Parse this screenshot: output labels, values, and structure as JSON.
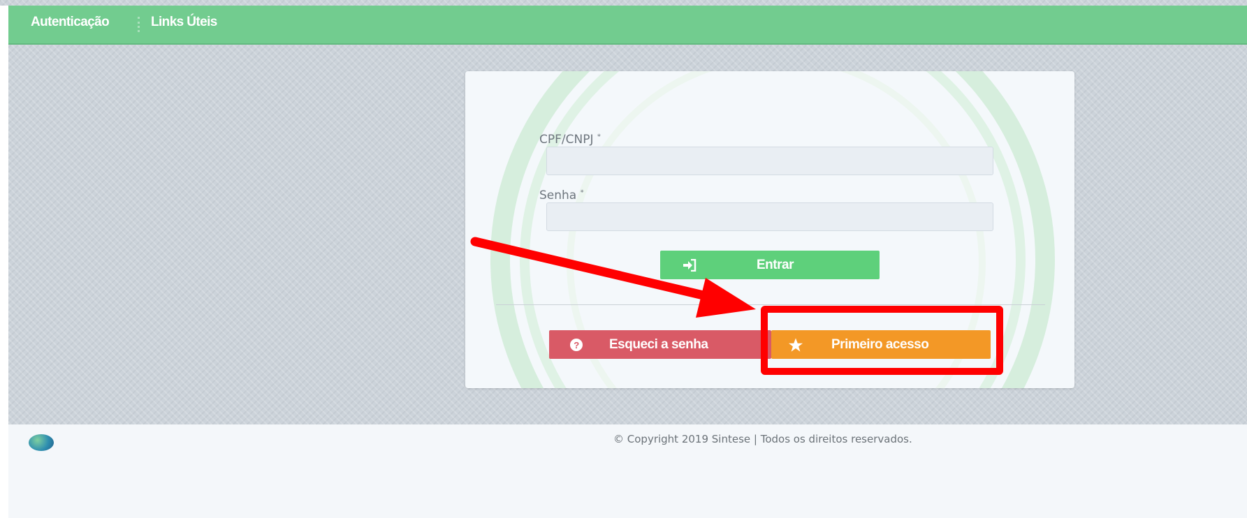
{
  "nav": {
    "items": [
      "Autenticação",
      "Links Úteis"
    ]
  },
  "form": {
    "cpf_label": "CPF/CNPJ",
    "cpf_required": "*",
    "password_label": "Senha",
    "password_required": "*",
    "cpf_value": "",
    "password_value": ""
  },
  "buttons": {
    "enter_label": "Entrar",
    "enter_icon": "sign-in-icon",
    "forgot_label": "Esqueci a senha",
    "forgot_icon": "question-circle-icon",
    "first_access_label": "Primeiro acesso",
    "first_access_icon": "star-icon"
  },
  "footer": {
    "copyright": "© Copyright 2019 Sintese | Todos os direitos reservados."
  },
  "colors": {
    "topbar": "#72cc8f",
    "enter": "#5ed07b",
    "forgot": "#d95a66",
    "first_access": "#f39826",
    "annotation": "#ff0000"
  }
}
